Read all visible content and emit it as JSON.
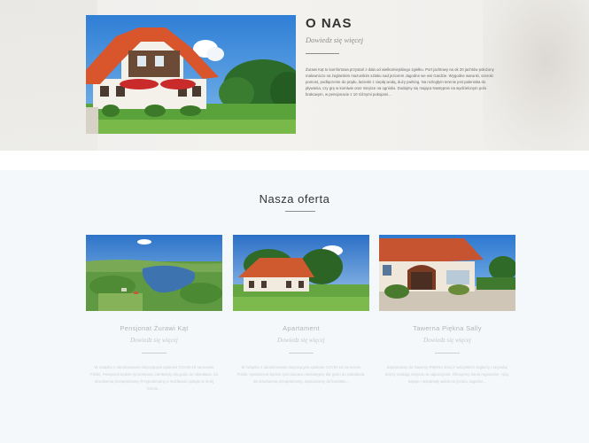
{
  "about": {
    "title": "O NAS",
    "subtitle": "Dowiedz się więcej",
    "body": "Żurawi Kąt to komfortowa przystań z dala od wielkomiejskiego zgiełku. Port jachtowy na ok 20 jachtów położony malowniczo na żeglarskim mazurskim szlaku nad jeziorem Jagodne we wsi Gardzie. Wygodne warunki, szeroki pomost, podłączenie do prądu, łazienki z ciepłą wodą, duży parking. Na rozległym terenie jest paleniska do pływania, czy grę w komiwie oraz miejsce na ognisko. Dodajmy się mająca Następnie na wydzielonym polu brakowym, w pensjonacie z 10 różnymi pokojami..."
  },
  "offer": {
    "title": "Nasza oferta",
    "cards": [
      {
        "title": "Pensjonat Żurawi Kąt",
        "subtitle": "Dowiedz się więcej",
        "body": "W związku z obostrzeniami dotyczącymi epidemii COVID-19 na terenie Polski, Pensjonat będzie tymczasowo zamknięty dla gości do odwołania. Za utrudnienia przepraszamy. Przypominamy o możliwości pobytu w innej formie..."
      },
      {
        "title": "Apartament",
        "subtitle": "Dowiedz się więcej",
        "body": "W związku z obostrzeniami dotyczącymi epidemii COVID-19 na terenie Polski, Apartament będzie tymczasowo niedostępny dla gości do odwołania. Za utrudnienia przepraszamy. Zapraszamy do kontaktu..."
      },
      {
        "title": "Tawerna Piękna Sally",
        "subtitle": "Dowiedz się więcej",
        "body": "Zapraszamy do Tawerny PIĘKNA SALLY wszystkich żeglarzy i turystów, którzy szukają miejsca na odpoczynek. Oferujemy dania regionalne, ryby, napoje i wspaniały widok na jezioro Jagodne..."
      }
    ]
  }
}
